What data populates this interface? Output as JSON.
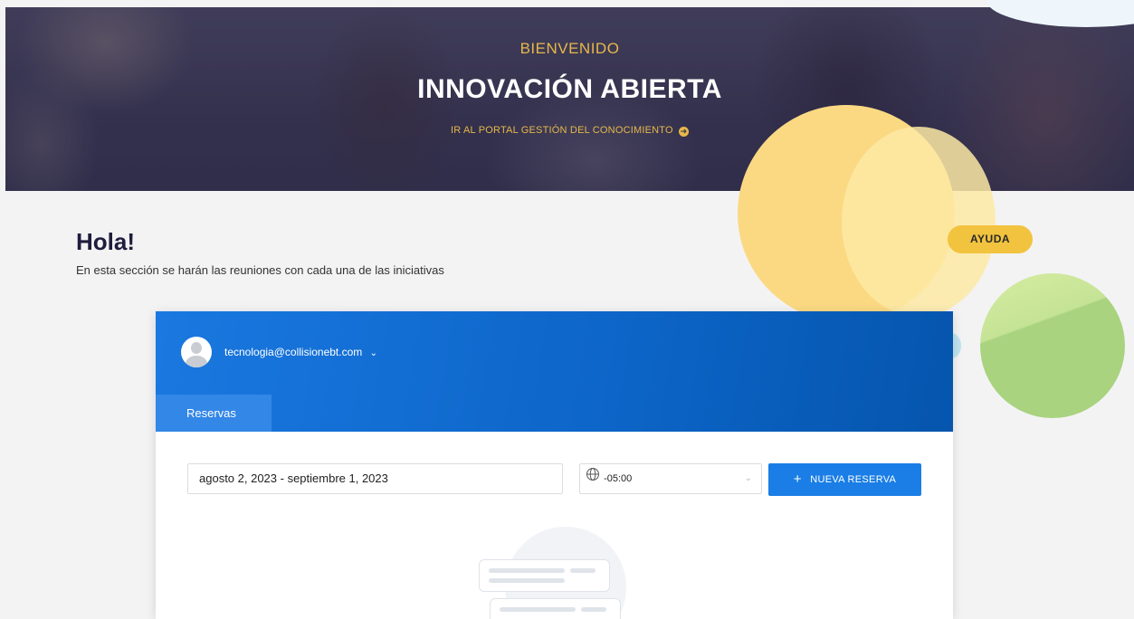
{
  "hero": {
    "kicker": "BIENVENIDO",
    "title": "INNOVACIÓN ABIERTA",
    "link": "IR AL PORTAL GESTIÓN DEL CONOCIMIENTO",
    "link_icon": "arrow-right-circle-icon",
    "accent_color": "#e7b84a"
  },
  "greeting": {
    "title": "Hola!",
    "subtitle": "En esta sección se harán las reuniones con cada una de las iniciativas",
    "help_label": "AYUDA"
  },
  "widget": {
    "user_email": "tecnologia@collisionebt.com",
    "tabs": [
      {
        "label": "Reservas",
        "active": true
      }
    ],
    "date_range": "agosto 2, 2023 - septiembre 1, 2023",
    "timezone": "-05:00",
    "new_button": "NUEVA RESERVA",
    "header_color": "#1a78e0",
    "button_color": "#1a7ee6"
  }
}
